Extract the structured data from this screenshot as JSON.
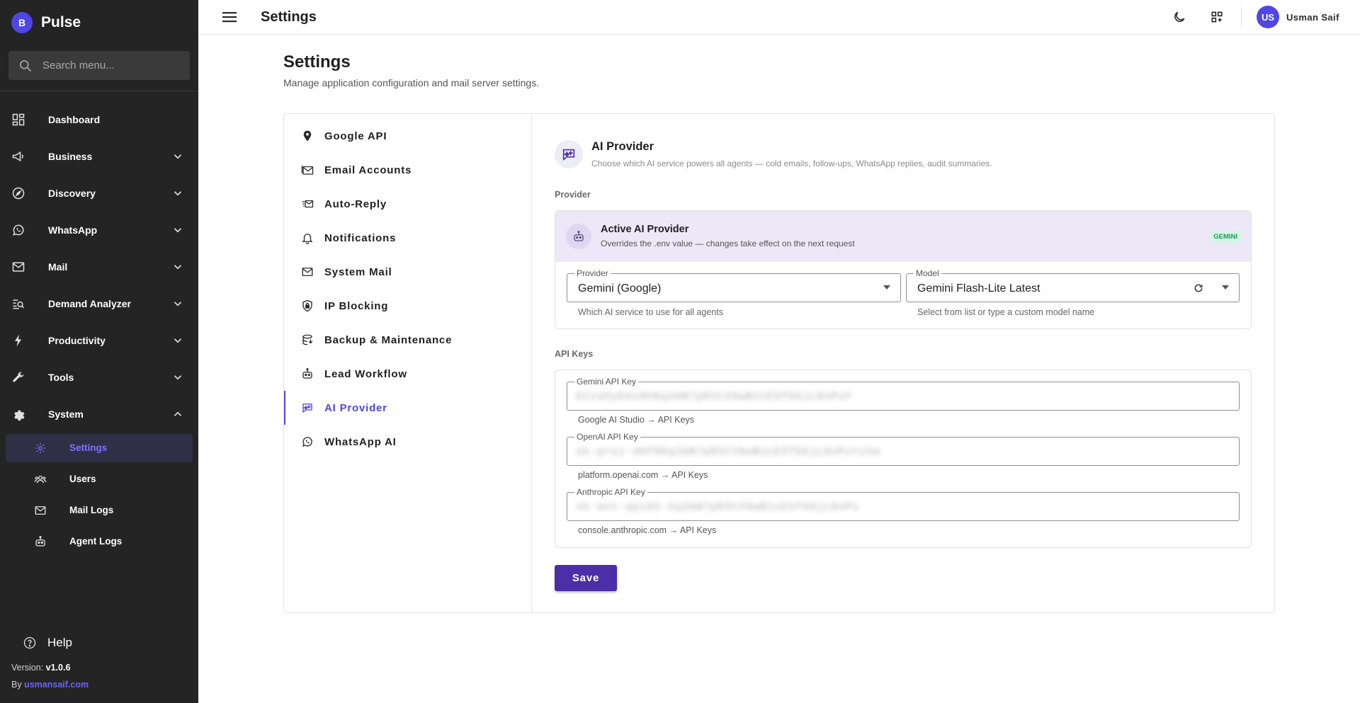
{
  "app": {
    "brand_initial": "B",
    "brand_name": "Pulse",
    "accent": "#4f46e5"
  },
  "sidebar": {
    "search_placeholder": "Search menu...",
    "items": [
      {
        "label": "Dashboard",
        "icon": "dashboard-icon",
        "expandable": false
      },
      {
        "label": "Business",
        "icon": "megaphone-icon",
        "expandable": true
      },
      {
        "label": "Discovery",
        "icon": "compass-icon",
        "expandable": true
      },
      {
        "label": "WhatsApp",
        "icon": "whatsapp-icon",
        "expandable": true
      },
      {
        "label": "Mail",
        "icon": "mail-icon",
        "expandable": true
      },
      {
        "label": "Demand Analyzer",
        "icon": "search-chart-icon",
        "expandable": true
      },
      {
        "label": "Productivity",
        "icon": "bolt-icon",
        "expandable": true
      },
      {
        "label": "Tools",
        "icon": "wrench-icon",
        "expandable": true
      },
      {
        "label": "System",
        "icon": "gear-icon",
        "expandable": true,
        "expanded": true
      }
    ],
    "system_subitems": [
      {
        "label": "Settings",
        "icon": "gear-icon",
        "active": true
      },
      {
        "label": "Users",
        "icon": "users-icon",
        "active": false
      },
      {
        "label": "Mail Logs",
        "icon": "mail-icon",
        "active": false
      },
      {
        "label": "Agent Logs",
        "icon": "robot-icon",
        "active": false
      }
    ],
    "help_label": "Help",
    "version_prefix": "Version:",
    "version": "v1.0.6",
    "by_prefix": "By",
    "by_link": "usmansaif.com"
  },
  "topbar": {
    "title": "Settings",
    "user_initials": "US",
    "user_name": "Usman Saif"
  },
  "page": {
    "title": "Settings",
    "subtitle": "Manage application configuration and mail server settings."
  },
  "tabs": [
    {
      "label": "Google API",
      "icon": "location-pin-icon",
      "active": false
    },
    {
      "label": "Email Accounts",
      "icon": "mail-stack-icon",
      "active": false
    },
    {
      "label": "Auto-Reply",
      "icon": "fast-mail-icon",
      "active": false
    },
    {
      "label": "Notifications",
      "icon": "bell-icon",
      "active": false
    },
    {
      "label": "System Mail",
      "icon": "envelope-icon",
      "active": false
    },
    {
      "label": "IP Blocking",
      "icon": "shield-lock-icon",
      "active": false
    },
    {
      "label": "Backup & Maintenance",
      "icon": "backup-icon",
      "active": false
    },
    {
      "label": "Lead Workflow",
      "icon": "robot-icon",
      "active": false
    },
    {
      "label": "AI Provider",
      "icon": "ai-chat-icon",
      "active": true
    },
    {
      "label": "WhatsApp AI",
      "icon": "whatsapp-icon",
      "active": false
    }
  ],
  "panel": {
    "title": "AI Provider",
    "subtitle": "Choose which AI service powers all agents — cold emails, follow-ups, WhatsApp replies, audit summaries.",
    "provider_group_label": "Provider",
    "active_box": {
      "title": "Active AI Provider",
      "subtitle": "Overrides the .env value — changes take effect on the next request",
      "badge": "GEMINI"
    },
    "provider_field": {
      "label": "Provider",
      "value": "Gemini (Google)",
      "helper": "Which AI service to use for all agents"
    },
    "model_field": {
      "label": "Model",
      "value": "Gemini Flash-Lite Latest",
      "helper": "Select from list or type a custom model name"
    },
    "keys_group_label": "API Keys",
    "keys": [
      {
        "label": "Gemini API Key",
        "value": "AIzaSyD4x8hKq2mN7pR3tV9wB1cE5fG6jL0oPuY",
        "helper": "Google AI Studio → API Keys"
      },
      {
        "label": "OpenAI API Key",
        "value": "sk-proj-4Hf8Kq2mN7pR3tV9wB1cE5fG6jL0oPuYzXa",
        "helper": "platform.openai.com → API Keys"
      },
      {
        "label": "Anthropic API Key",
        "value": "sk-ant-api03-Xq2mN7pR3tV9wB1cE5fG6jL0oPu",
        "helper": "console.anthropic.com → API Keys"
      }
    ],
    "save_label": "Save"
  }
}
